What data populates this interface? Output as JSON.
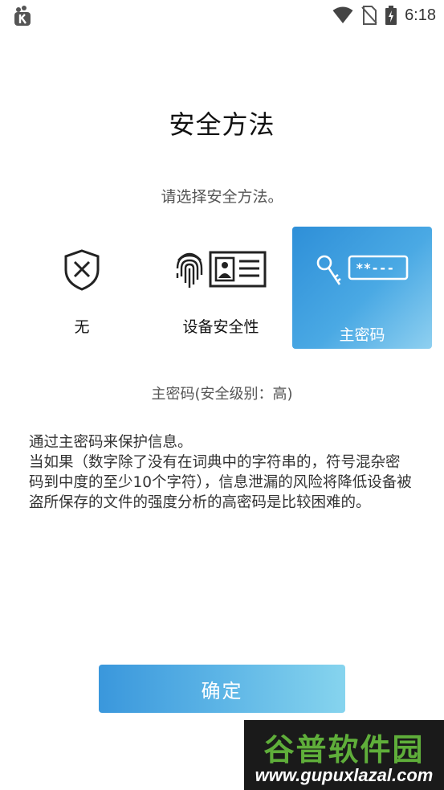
{
  "status_bar": {
    "time": "6:18",
    "icons": [
      "app-notification-icon",
      "wifi-icon",
      "no-sim-icon",
      "battery-charging-icon"
    ]
  },
  "title": "安全方法",
  "subtitle": "请选择安全方法。",
  "options": [
    {
      "label": "无",
      "icon": "shield-x-icon",
      "selected": false
    },
    {
      "label": "设备安全性",
      "icon": "fingerprint-id-card-icon",
      "selected": false
    },
    {
      "label": "主密码",
      "icon": "key-password-icon",
      "selected": true
    }
  ],
  "security_level": "主密码(安全级别：高)",
  "description_lines": [
    "通过主密码来保护信息。",
    "当如果（数字除了没有在词典中的字符串的，符号混杂密码到中度的至少10个字符），信息泄漏的风险将降低设备被盗所保存的文件的强度分析的高密码是比较困难的。"
  ],
  "confirm_label": "确定",
  "watermark": {
    "title": "谷普软件园",
    "url": "www.gupuxlazal.com"
  },
  "colors": {
    "accent_start": "#2e8fd8",
    "accent_end": "#8fd0f0",
    "watermark_green": "#5fae3a"
  }
}
